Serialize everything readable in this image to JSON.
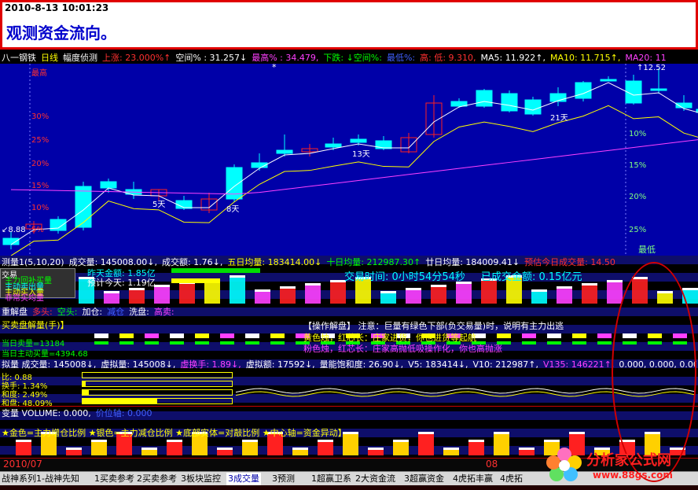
{
  "top": {
    "timestamp": "2010-8-13 10:01:23",
    "caption": "观测资金流向。"
  },
  "header": {
    "items": [
      {
        "t": "八一钢铁",
        "c": "w"
      },
      {
        "t": "日线",
        "c": "y"
      },
      {
        "t": "幅度侦测",
        "c": "w"
      },
      {
        "t": "上涨: 23.000%↑",
        "c": "r"
      },
      {
        "t": "空间% : 31.257↓",
        "c": "w"
      },
      {
        "t": "最高% : 34.479,",
        "c": "m"
      },
      {
        "t": "下跌: ↓空间%:",
        "c": "g"
      },
      {
        "t": "最低%:",
        "c": "b"
      },
      {
        "t": "高: 低: 9.310,",
        "c": "r"
      },
      {
        "t": "MA5: 11.922↑,",
        "c": "w"
      },
      {
        "t": "MA10: 11.715↑,",
        "c": "y"
      },
      {
        "t": "MA20: 11",
        "c": "m"
      }
    ]
  },
  "main_chart": {
    "left_pct": [
      "最高",
      "30%",
      "25%",
      "20%",
      "15%",
      "10%",
      "5%"
    ],
    "right_pct": [
      "10%",
      "15%",
      "20%",
      "25%"
    ],
    "top_price": "12.52",
    "bottom_price": "8.88",
    "bottom_right": "最低",
    "day_labels": [
      "5天",
      "8天",
      "13天",
      "21天"
    ],
    "colors": {
      "up": "#ff2020",
      "down": "#00ffff",
      "ma5": "#ffffff",
      "ma10": "#ffff00",
      "ma20": "#ff40ff"
    }
  },
  "vol_header": {
    "items": [
      {
        "t": "测量1(5,10,20)",
        "c": "w"
      },
      {
        "t": "成交量: 145008.00↓,",
        "c": "w"
      },
      {
        "t": "成交额: 1.76↓,",
        "c": "w"
      },
      {
        "t": "五日均量: 183414.00↓",
        "c": "y"
      },
      {
        "t": "十日均量: 212987.30↑",
        "c": "g"
      },
      {
        "t": "廿日均量: 184009.41↓",
        "c": "w"
      },
      {
        "t": "预估今日成交量: 14.50",
        "c": "r"
      }
    ]
  },
  "vol_panel": {
    "labels": [
      "交易",
      "主力回补买量",
      "主动卖出量",
      "主动买入量",
      "非常买均量"
    ],
    "y_amount": "昨天金额: 1.85亿",
    "est_today": "预计今天: 1.19亿",
    "trade_time": "交易时间: 0小时54分54秒",
    "traded_amount": "已成交金额: 0.15亿元"
  },
  "wash": {
    "items": [
      {
        "t": "重解盘",
        "c": "w"
      },
      {
        "t": "多头:",
        "c": "r"
      },
      {
        "t": "空头:",
        "c": "g"
      },
      {
        "t": "加仓:",
        "c": "w"
      },
      {
        "t": "减仓",
        "c": "b"
      },
      {
        "t": "洗盘:",
        "c": "w"
      },
      {
        "t": "高卖:",
        "c": "m"
      }
    ]
  },
  "bsp": {
    "title": "买卖盘解量(手)】",
    "cur_sell": "当日卖量=13184",
    "cur_buy": "当日主动买量=4394.68",
    "note_title": "【操作解盘】 注意：巨量有绿色下部(负交易量)时，说明有主力出逃",
    "note1": "黄色烛，红芯长：庄家进货，你也进货等起航",
    "note2": "粉色烛，红芯长：庄家高抛低吸操作化，你也高抛涨"
  },
  "turnover": {
    "header": [
      {
        "t": "拟量 成交量: 145008↓,",
        "c": "w"
      },
      {
        "t": "虚拟量: 145008↓,",
        "c": "w"
      },
      {
        "t": "虚换手: 1.89↓,",
        "c": "m"
      },
      {
        "t": "虚拟额: 17592↓,",
        "c": "w"
      },
      {
        "t": "量能饱和度: 26.90↓,",
        "c": "w"
      },
      {
        "t": "V5: 183414↓,",
        "c": "w"
      },
      {
        "t": "V10: 212987↑,",
        "c": "w"
      },
      {
        "t": "V135: 146221↑,",
        "c": "m"
      },
      {
        "t": "0.000, 0.000, 0.000",
        "c": "w"
      }
    ],
    "rows": [
      {
        "label": "比: 0.88",
        "fill": 0.0
      },
      {
        "label": "换手: 1.34%",
        "fill": 0.02
      },
      {
        "label": "和度: 2.49%",
        "fill": 0.04
      },
      {
        "label": "和盘: 48.09%",
        "fill": 0.5
      }
    ]
  },
  "ratio": {
    "header": "变量 VOLUME: 0.000,",
    "header2": "价位轴: 0.000",
    "legend": "★金色=主力增仓比例  ★银色=主力减仓比例  ★底部实体=对敲比例  ★中心轴=资金异动】",
    "year_l": "2010/07",
    "mark_r": "08"
  },
  "tabs": [
    "战神系列1-战神先知",
    "1买卖参考",
    "2买卖参考",
    "3板块监控",
    "3成交量",
    "3预测",
    "1超赢卫系",
    "2大资金流",
    "3超赢资金",
    "4虎拓丰赢",
    "4虎拓"
  ],
  "active_tab": 4,
  "logo": {
    "title": "分析家公式网",
    "url": "www.88gs.com"
  }
}
